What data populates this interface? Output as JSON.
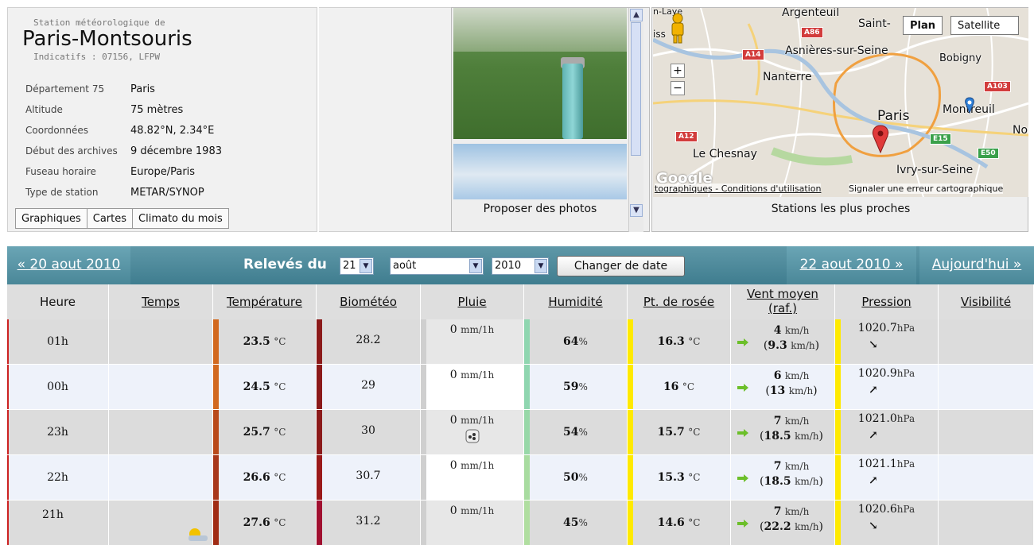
{
  "station": {
    "prefix": "Station météorologique de",
    "name": "Paris-Montsouris",
    "ids": "Indicatifs : 07156, LFPW",
    "rows": [
      {
        "k": "Département 75",
        "v": "Paris"
      },
      {
        "k": "Altitude",
        "v": "75 mètres"
      },
      {
        "k": "Coordonnées",
        "v": "48.82°N, 2.34°E"
      },
      {
        "k": "Début des archives",
        "v": "9 décembre 1983"
      },
      {
        "k": "Fuseau horaire",
        "v": "Europe/Paris"
      },
      {
        "k": "Type de station",
        "v": "METAR/SYNOP"
      }
    ],
    "tabs": [
      "Graphiques",
      "Cartes",
      "Climato du mois"
    ]
  },
  "photos": {
    "caption": "Proposer des photos"
  },
  "map": {
    "caption": "Stations les plus proches",
    "plan": "Plan",
    "satellite": "Satellite",
    "labels": {
      "argenteuil": "Argenteuil",
      "saint": "Saint-",
      "asnieres": "Asnières-sur-Seine",
      "bobigny": "Bobigny",
      "nanterre": "Nanterre",
      "paris": "Paris",
      "montreuil": "Montreuil",
      "noi": "Noi",
      "lechesnay": "Le Chesnay",
      "ivry": "Ivry-sur-Seine",
      "enlaye": "n-Laye",
      "iss": "iss"
    },
    "badges": {
      "a86": "A86",
      "a14": "A14",
      "a103": "A103",
      "a12": "A12",
      "e15": "E15",
      "e50": "E50"
    },
    "footer_links": "tographiques - Conditions d'utilisation",
    "footer_report": "Signaler une erreur cartographique",
    "google": "Google",
    "zoom_in": "+",
    "zoom_out": "−"
  },
  "nav": {
    "prev": "« 20 aout 2010",
    "next": "22 aout 2010 »",
    "today": "Aujourd'hui »",
    "label": "Relevés du",
    "day": "21",
    "month": "août",
    "year": "2010",
    "change": "Changer de date"
  },
  "table": {
    "headers": {
      "heure": "Heure",
      "temps": "Temps",
      "temperature": "Température",
      "biometeo": "Biométéo",
      "pluie": "Pluie",
      "humidite": "Humidité",
      "rosee": "Pt. de rosée",
      "vent1": "Vent moyen",
      "vent2": "(raf.)",
      "pression": "Pression",
      "visibilite": "Visibilité"
    },
    "units": {
      "temp": "°C",
      "rain": "mm/1h",
      "hum": "%",
      "wind": "km/h",
      "press": "hPa"
    },
    "rows": [
      {
        "heure": "01h",
        "temp": "23.5",
        "bio": "28.2",
        "rain": "0",
        "hum": "64",
        "dew": "16.3",
        "wind": "4",
        "gust": "9.3",
        "press": "1020.7",
        "parrow": "↘"
      },
      {
        "heure": "00h",
        "temp": "24.5",
        "bio": "29",
        "rain": "0",
        "hum": "59",
        "dew": "16",
        "wind": "6",
        "gust": "13",
        "press": "1020.9",
        "parrow": "↗"
      },
      {
        "heure": "23h",
        "temp": "25.7",
        "bio": "30",
        "rain": "0",
        "hum": "54",
        "dew": "15.7",
        "wind": "7",
        "gust": "18.5",
        "press": "1021.0",
        "parrow": "↗"
      },
      {
        "heure": "22h",
        "temp": "26.6",
        "bio": "30.7",
        "rain": "0",
        "hum": "50",
        "dew": "15.3",
        "wind": "7",
        "gust": "18.5",
        "press": "1021.1",
        "parrow": "↗"
      },
      {
        "heure": "21h",
        "temp": "27.6",
        "bio": "31.2",
        "rain": "0",
        "hum": "45",
        "dew": "14.6",
        "wind": "7",
        "gust": "22.2",
        "press": "1020.6",
        "parrow": "↘"
      }
    ]
  },
  "colors": {
    "nav_bg": "#4a8798",
    "temp_bar": "#d2691e",
    "bio_bar": "#8b1a1a",
    "hum_bar": "#8fd6b0",
    "dew_bar": "#ffea00",
    "press_bar": "#ffea00",
    "row_marker": "#cc2222"
  }
}
